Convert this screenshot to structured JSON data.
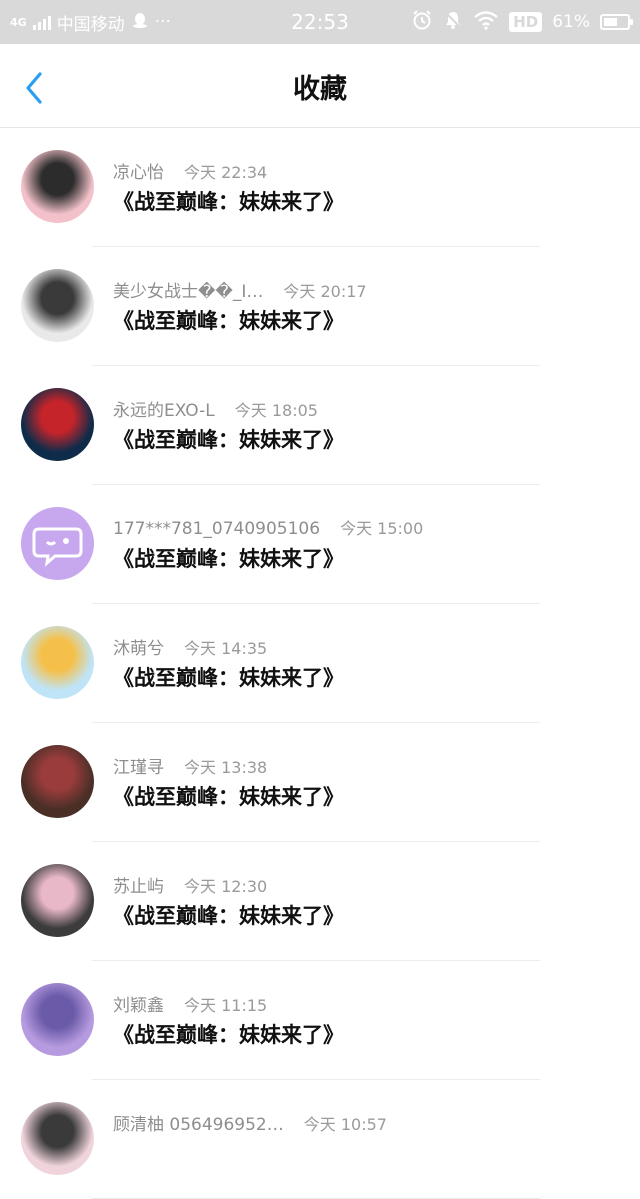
{
  "status_bar": {
    "network": "4G",
    "carrier": "中国移动",
    "more": "···",
    "time": "22:53",
    "hd": "HD",
    "battery": "61%",
    "battery_level": 0.61
  },
  "header": {
    "title": "收藏"
  },
  "colors": {
    "accent": "#2a9df4",
    "status_bar_bg": "#d9d9d9"
  },
  "items": [
    {
      "name": "凉心怡",
      "time": "今天 22:34",
      "message": "《战至巅峰：妹妹来了》",
      "avatar_colors": [
        "#f2c1c9",
        "#2c2c2c"
      ]
    },
    {
      "name": "美少女战士��_I…",
      "time": "今天 20:17",
      "message": "《战至巅峰：妹妹来了》",
      "avatar_colors": [
        "#e9e9e9",
        "#3a3a3a"
      ]
    },
    {
      "name": "永远的EXO-L",
      "time": "今天 18:05",
      "message": "《战至巅峰：妹妹来了》",
      "avatar_colors": [
        "#0e2c4a",
        "#c4242a"
      ]
    },
    {
      "name": "177***781_0740905106",
      "time": "今天 15:00",
      "message": "《战至巅峰：妹妹来了》",
      "avatar_colors": [
        "#c7a7ee",
        "#ffffff"
      ]
    },
    {
      "name": "沐萌兮",
      "time": "今天 14:35",
      "message": "《战至巅峰：妹妹来了》",
      "avatar_colors": [
        "#bfe4f7",
        "#f5c04a"
      ]
    },
    {
      "name": "江瑾寻",
      "time": "今天 13:38",
      "message": "《战至巅峰：妹妹来了》",
      "avatar_colors": [
        "#4a2f27",
        "#9a3c3c"
      ]
    },
    {
      "name": "苏止屿",
      "time": "今天 12:30",
      "message": "《战至巅峰：妹妹来了》",
      "avatar_colors": [
        "#3c3c3c",
        "#e8b7c8"
      ]
    },
    {
      "name": "刘颖鑫",
      "time": "今天 11:15",
      "message": "《战至巅峰：妹妹来了》",
      "avatar_colors": [
        "#b79be0",
        "#6a5aa8"
      ]
    },
    {
      "name": "顾清柚 056496952…",
      "time": "今天 10:57",
      "message": "",
      "avatar_colors": [
        "#f0d4dc",
        "#3a3a3a"
      ]
    }
  ]
}
